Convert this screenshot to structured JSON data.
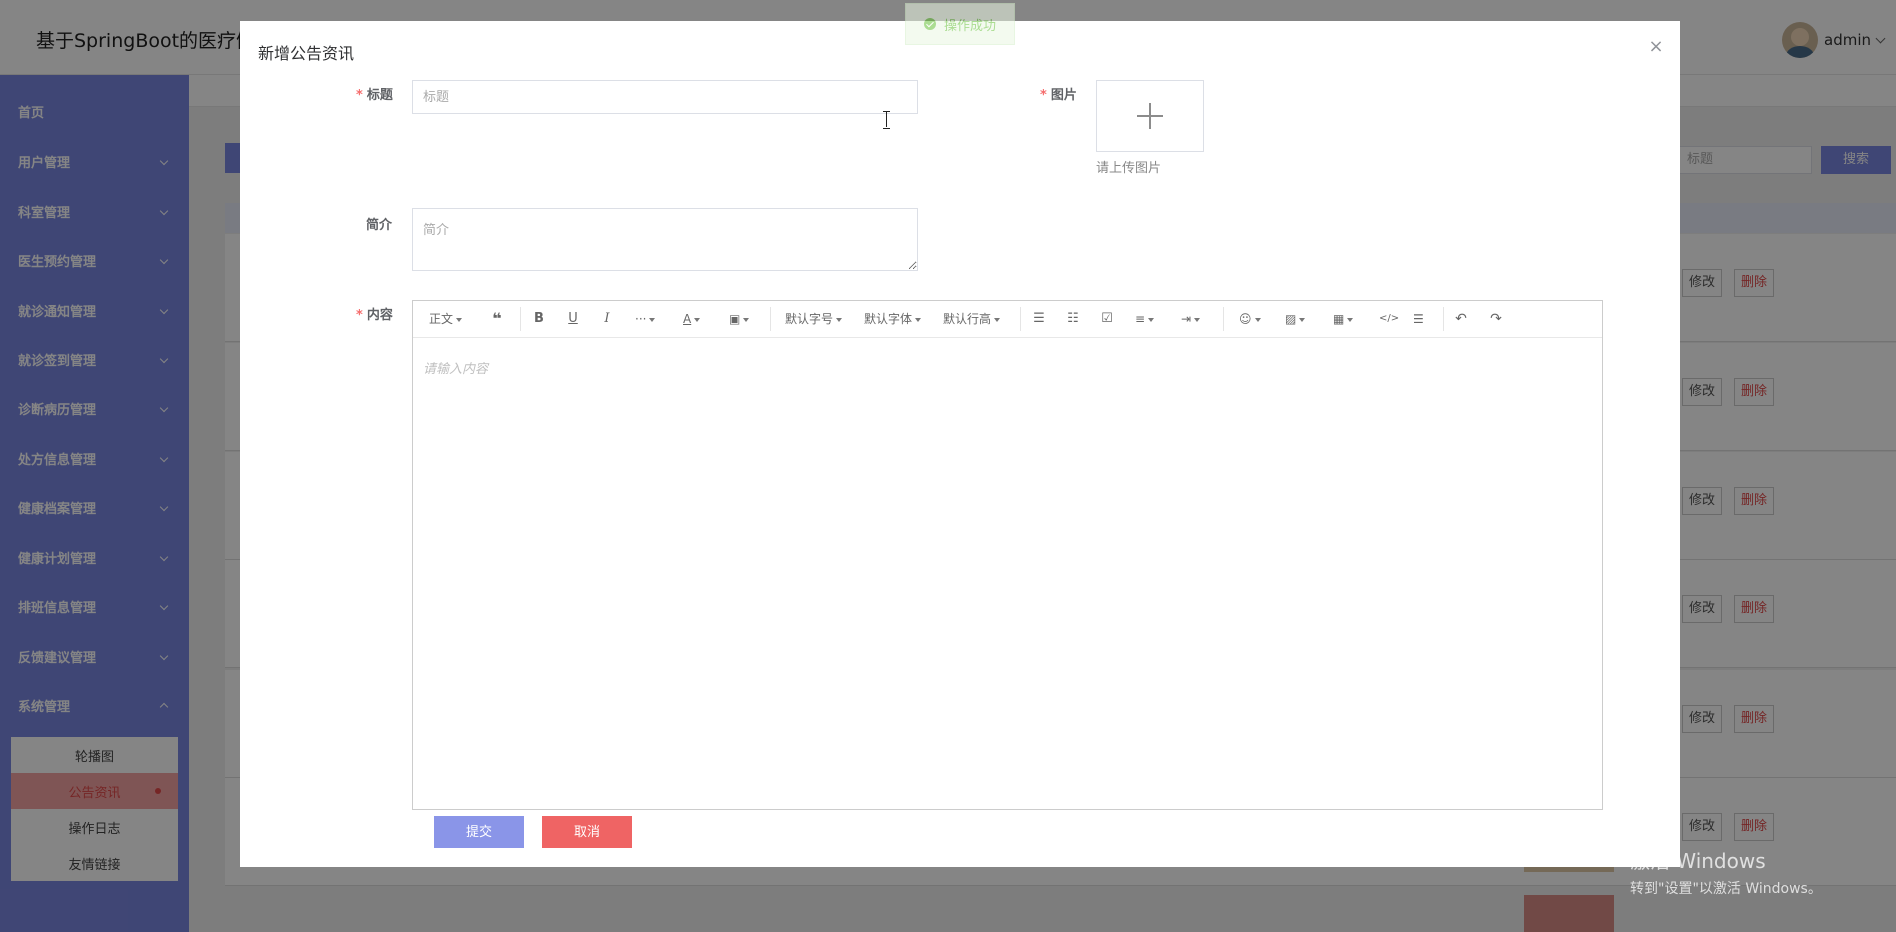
{
  "app": {
    "title": "基于SpringBoot的医疗健",
    "username": "admin"
  },
  "sidebar": {
    "items": [
      {
        "label": "首页"
      },
      {
        "label": "用户管理"
      },
      {
        "label": "科室管理"
      },
      {
        "label": "医生预约管理"
      },
      {
        "label": "就诊通知管理"
      },
      {
        "label": "就诊签到管理"
      },
      {
        "label": "诊断病历管理"
      },
      {
        "label": "处方信息管理"
      },
      {
        "label": "健康档案管理"
      },
      {
        "label": "健康计划管理"
      },
      {
        "label": "排班信息管理"
      },
      {
        "label": "反馈建议管理"
      },
      {
        "label": "系统管理"
      }
    ],
    "submenu": [
      {
        "label": "轮播图"
      },
      {
        "label": "公告资讯"
      },
      {
        "label": "操作日志"
      },
      {
        "label": "友情链接"
      }
    ]
  },
  "background": {
    "search_placeholder": "标题",
    "search_button": "搜索",
    "edit_label": "修改",
    "delete_label": "删除"
  },
  "toast": {
    "message": "操作成功"
  },
  "dialog": {
    "title": "新增公告资讯",
    "close_glyph": "×",
    "fields": {
      "title_label": "标题",
      "title_placeholder": "标题",
      "image_label": "图片",
      "image_tip": "请上传图片",
      "summary_label": "简介",
      "summary_placeholder": "简介",
      "content_label": "内容",
      "content_placeholder": "请输入内容"
    },
    "editor_toolbar": {
      "paragraph": "正文",
      "font_size": "默认字号",
      "font_family": "默认字体",
      "line_height": "默认行高"
    },
    "submit_label": "提交",
    "cancel_label": "取消"
  },
  "watermark": {
    "line1": "激活 Windows",
    "line2": "转到\"设置\"以激活 Windows。"
  }
}
